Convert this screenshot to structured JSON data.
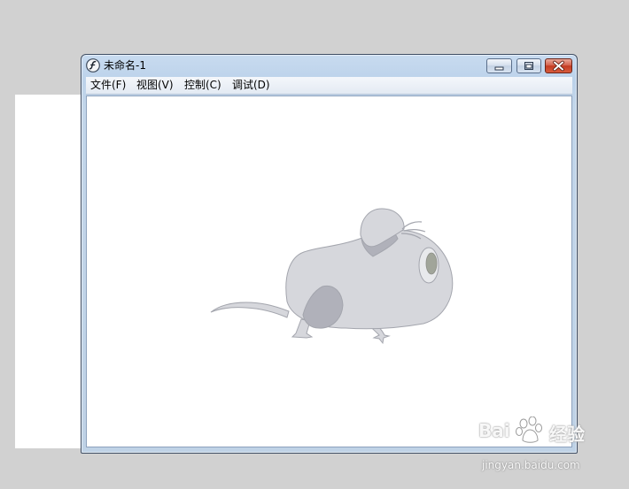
{
  "window": {
    "title": "未命名-1"
  },
  "menu": {
    "items": [
      {
        "label": "文件(F)"
      },
      {
        "label": "视图(V)"
      },
      {
        "label": "控制(C)"
      },
      {
        "label": "调试(D)"
      }
    ]
  },
  "watermark": {
    "brand_left": "Bai",
    "brand_right": "经验",
    "url": "jingyan.baidu.com"
  },
  "icons": {
    "app": "flash-player-icon",
    "minimize": "minimize-icon",
    "maximize": "maximize-icon",
    "close": "close-icon"
  },
  "colors": {
    "desktop": "#d1d1d1",
    "stage": "#ffffff",
    "mouse_body": "#d6d7dc",
    "mouse_shade": "#b0b1ba",
    "mouse_outline": "#a3a5ad"
  }
}
